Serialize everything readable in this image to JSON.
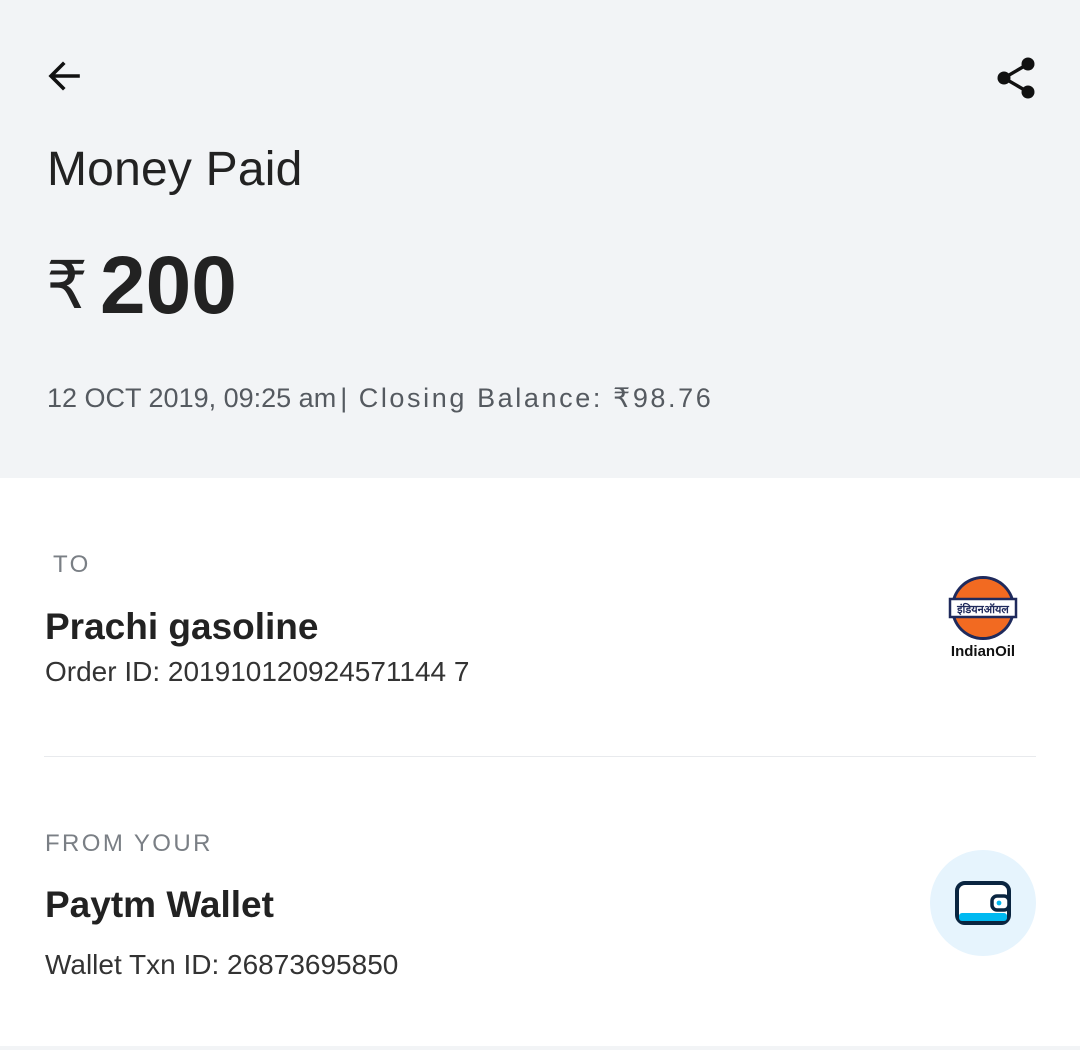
{
  "header": {
    "title": "Money Paid",
    "currency_symbol": "₹",
    "amount": "200",
    "datetime": "12 OCT 2019, 09:25 am",
    "separator": "|",
    "closing_balance": "Closing Balance: ₹98.76",
    "back_icon": "arrow-left-icon",
    "share_icon": "share-icon"
  },
  "to": {
    "label": "TO",
    "name": "Prachi gasoline",
    "order_id": "Order ID: 201910120924571144 7",
    "logo_caption": "IndianOil",
    "logo_text": "इंडियनऑयल",
    "logo_colors": {
      "outer": "#1f2a5c",
      "inner": "#f26a21"
    }
  },
  "from": {
    "label": "FROM YOUR",
    "name": "Paytm Wallet",
    "txn_id": "Wallet Txn ID: 26873695850",
    "icon": "wallet-icon",
    "icon_bg": "#e6f4fd",
    "icon_color": "#0a2540",
    "accent": "#00b9f1"
  }
}
